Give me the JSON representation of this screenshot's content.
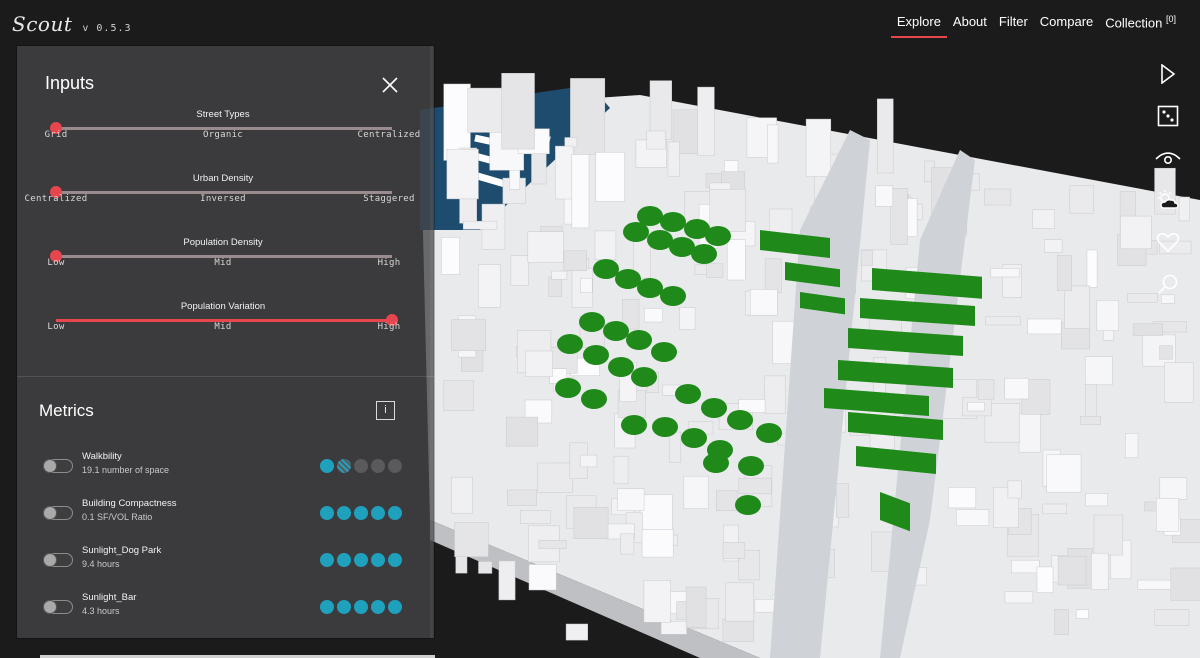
{
  "app": {
    "logo": "Scout",
    "version": "v 0.5.3"
  },
  "nav": [
    {
      "label": "Explore",
      "active": true
    },
    {
      "label": "About"
    },
    {
      "label": "Filter"
    },
    {
      "label": "Compare"
    },
    {
      "label": "Collection",
      "badge": "[0]"
    }
  ],
  "toolbar": [
    "play-icon",
    "dice-icon",
    "eye-icon",
    "weather-icon",
    "heart-icon",
    "search-icon"
  ],
  "inputs": {
    "title": "Inputs",
    "sliders": [
      {
        "title": "Street Types",
        "labels": [
          "Grid",
          "Organic",
          "Centralized"
        ],
        "value": 0.0
      },
      {
        "title": "Urban Density",
        "labels": [
          "Centralized",
          "Inversed",
          "Staggered"
        ],
        "value": 0.0
      },
      {
        "title": "Population Density",
        "labels": [
          "Low",
          "Mid",
          "High"
        ],
        "value": 0.0
      },
      {
        "title": "Population Variation",
        "labels": [
          "Low",
          "Mid",
          "High"
        ],
        "value": 1.0
      }
    ]
  },
  "metrics": {
    "title": "Metrics",
    "info_label": "i",
    "items": [
      {
        "name": "Walkbility",
        "value": "19.1 number of space",
        "score": 1.8
      },
      {
        "name": "Building Compactness",
        "value": "0.1 SF/VOL Ratio",
        "score": 5
      },
      {
        "name": "Sunlight_Dog Park",
        "value": "9.4 hours",
        "score": 5
      },
      {
        "name": "Sunlight_Bar",
        "value": "4.3 hours",
        "score": 5
      }
    ]
  },
  "colors": {
    "accent": "#e8464f",
    "metric_dot": "#1fa0bd",
    "park_green": "#1f8a1a",
    "water": "#1d4c6e"
  }
}
